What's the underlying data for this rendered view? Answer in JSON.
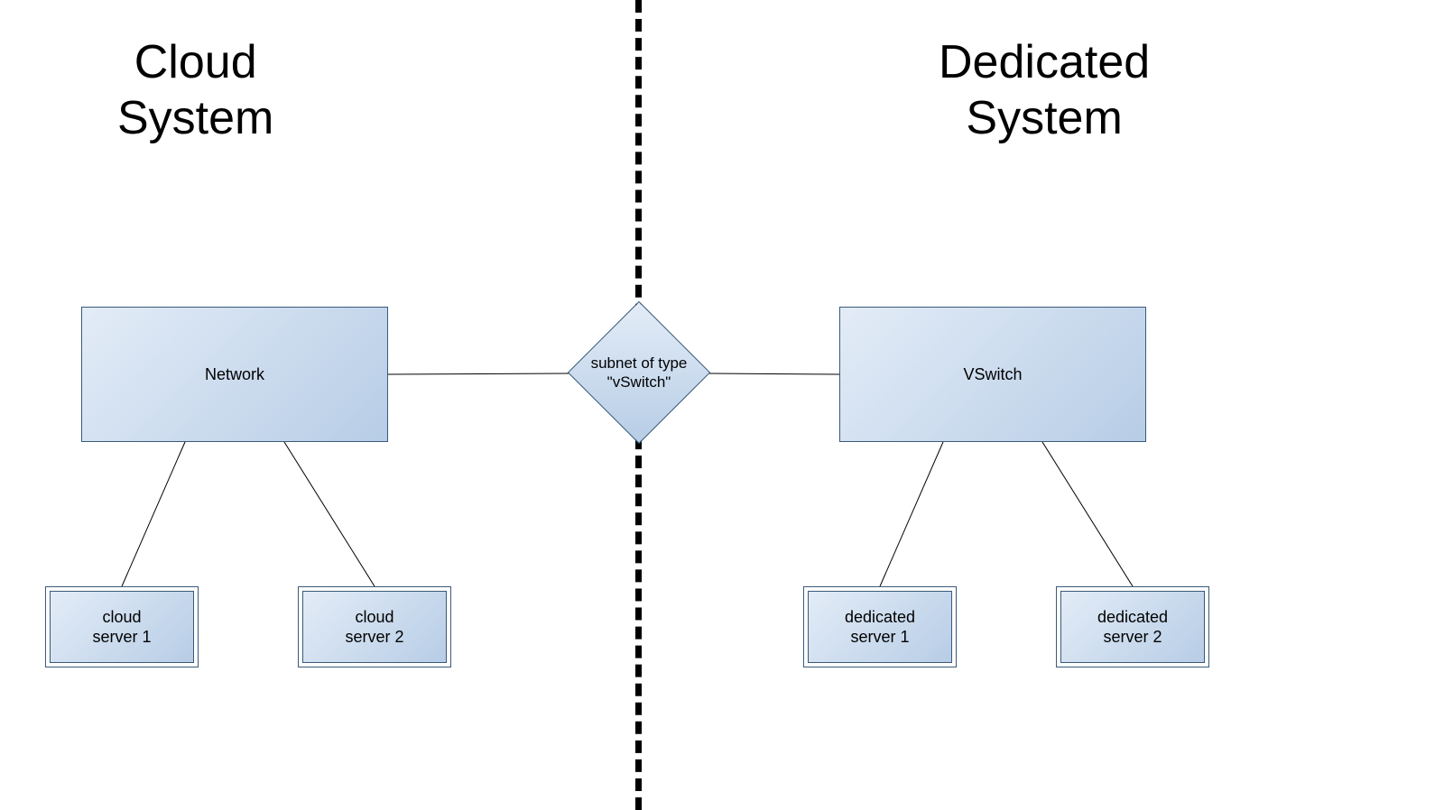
{
  "titles": {
    "left_line1": "Cloud",
    "left_line2": "System",
    "right_line1": "Dedicated",
    "right_line2": "System"
  },
  "nodes": {
    "network": "Network",
    "vswitch": "VSwitch",
    "diamond": "subnet of type\n\"vSwitch\""
  },
  "servers": {
    "cloud1": "cloud\nserver 1",
    "cloud2": "cloud\nserver 2",
    "ded1": "dedicated\nserver 1",
    "ded2": "dedicated\nserver 2"
  }
}
